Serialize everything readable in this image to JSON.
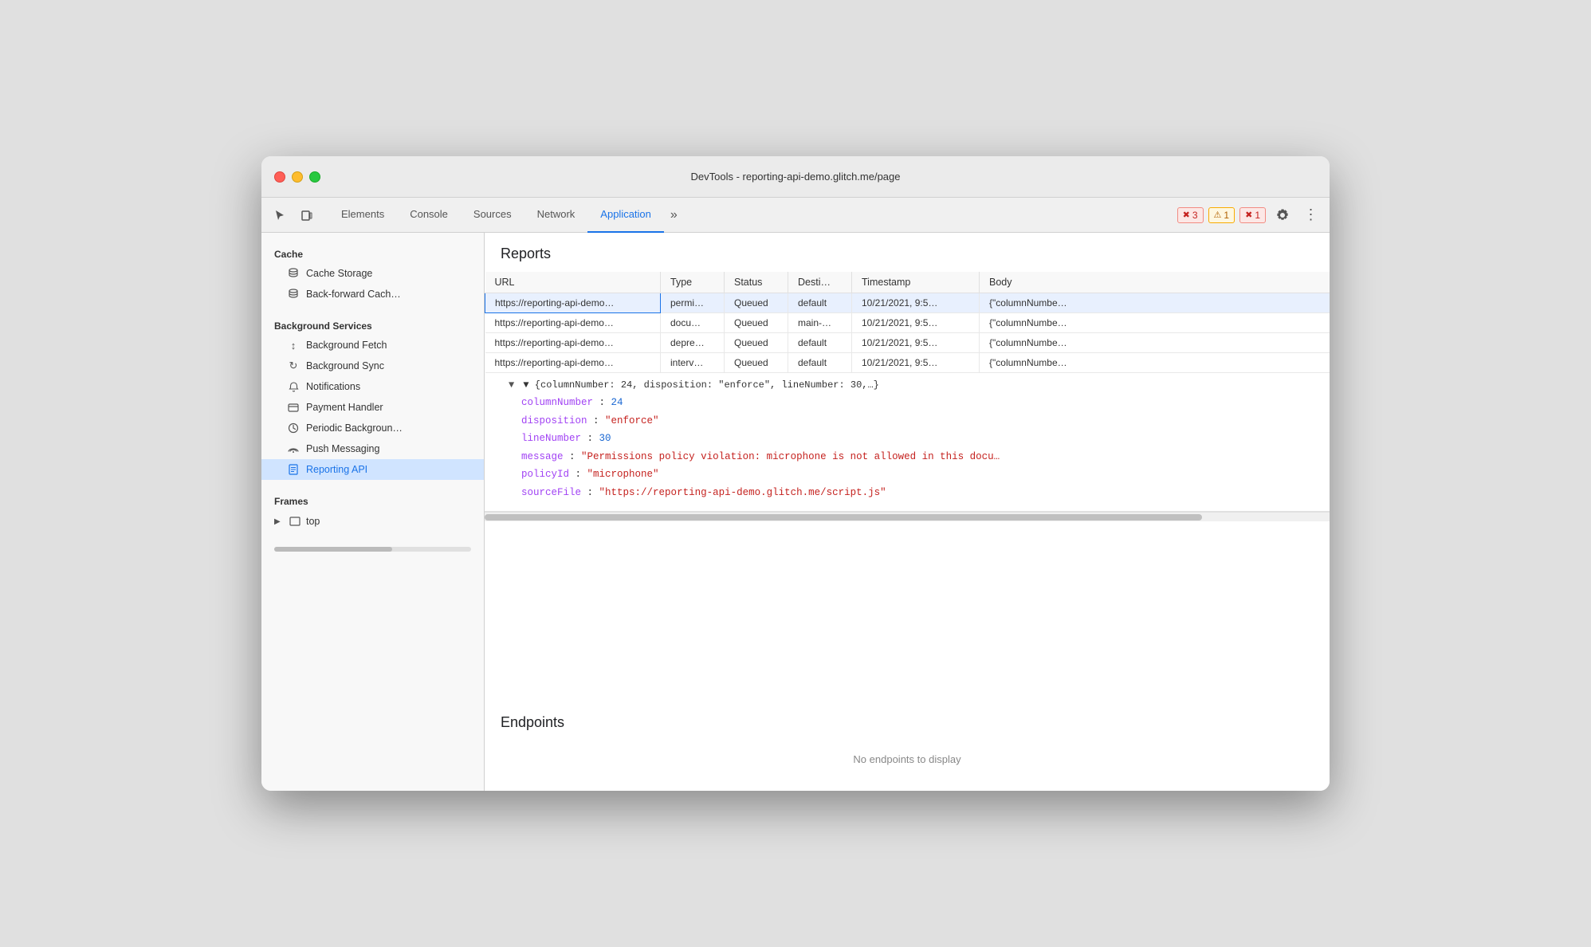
{
  "window": {
    "title": "DevTools - reporting-api-demo.glitch.me/page"
  },
  "toolbar": {
    "icons": [
      {
        "name": "cursor-icon",
        "symbol": "↖"
      },
      {
        "name": "device-icon",
        "symbol": "⬜"
      }
    ],
    "tabs": [
      {
        "id": "elements",
        "label": "Elements",
        "active": false
      },
      {
        "id": "console",
        "label": "Console",
        "active": false
      },
      {
        "id": "sources",
        "label": "Sources",
        "active": false
      },
      {
        "id": "network",
        "label": "Network",
        "active": false
      },
      {
        "id": "application",
        "label": "Application",
        "active": true
      }
    ],
    "more_tabs_symbol": "»",
    "error_badge": {
      "icon": "✖",
      "count": "3"
    },
    "warning_badge": {
      "icon": "⚠",
      "count": "1"
    },
    "error_badge2": {
      "icon": "✖",
      "count": "1"
    },
    "gear_symbol": "⚙",
    "more_symbol": "⋮"
  },
  "sidebar": {
    "sections": [
      {
        "label": "Cache",
        "items": [
          {
            "id": "cache-storage",
            "label": "Cache Storage",
            "icon": "🗄"
          },
          {
            "id": "back-forward-cache",
            "label": "Back-forward Cach…",
            "icon": "🗄"
          }
        ]
      },
      {
        "label": "Background Services",
        "items": [
          {
            "id": "background-fetch",
            "label": "Background Fetch",
            "icon": "↕"
          },
          {
            "id": "background-sync",
            "label": "Background Sync",
            "icon": "↻"
          },
          {
            "id": "notifications",
            "label": "Notifications",
            "icon": "🔔"
          },
          {
            "id": "payment-handler",
            "label": "Payment Handler",
            "icon": "💳"
          },
          {
            "id": "periodic-background",
            "label": "Periodic Backgroun…",
            "icon": "🕐"
          },
          {
            "id": "push-messaging",
            "label": "Push Messaging",
            "icon": "☁"
          },
          {
            "id": "reporting-api",
            "label": "Reporting API",
            "icon": "📄",
            "active": true
          }
        ]
      },
      {
        "label": "Frames",
        "items": [
          {
            "id": "top",
            "label": "top",
            "icon": "⬜",
            "hasArrow": true
          }
        ]
      }
    ]
  },
  "reports": {
    "title": "Reports",
    "table": {
      "columns": [
        "URL",
        "Type",
        "Status",
        "Desti…",
        "Timestamp",
        "Body"
      ],
      "rows": [
        {
          "url": "https://reporting-api-demo…",
          "type": "permi…",
          "status": "Queued",
          "destination": "default",
          "timestamp": "10/21/2021, 9:5…",
          "body": "{\"columnNumbe…",
          "selected": true
        },
        {
          "url": "https://reporting-api-demo…",
          "type": "docu…",
          "status": "Queued",
          "destination": "main-…",
          "timestamp": "10/21/2021, 9:5…",
          "body": "{\"columnNumbe…",
          "selected": false
        },
        {
          "url": "https://reporting-api-demo…",
          "type": "depre…",
          "status": "Queued",
          "destination": "default",
          "timestamp": "10/21/2021, 9:5…",
          "body": "{\"columnNumbe…",
          "selected": false
        },
        {
          "url": "https://reporting-api-demo…",
          "type": "interv…",
          "status": "Queued",
          "destination": "default",
          "timestamp": "10/21/2021, 9:5…",
          "body": "{\"columnNumbe…",
          "selected": false
        }
      ]
    },
    "expanded_detail": {
      "header": "▼ {columnNumber: 24, disposition: \"enforce\", lineNumber: 30,…}",
      "lines": [
        {
          "key": "columnNumber",
          "colon": ":",
          "value": "24",
          "type": "number"
        },
        {
          "key": "disposition",
          "colon": ":",
          "value": "\"enforce\"",
          "type": "string"
        },
        {
          "key": "lineNumber",
          "colon": ":",
          "value": "30",
          "type": "number"
        },
        {
          "key": "message",
          "colon": ":",
          "value": "\"Permissions policy violation: microphone is not allowed in this docu…",
          "type": "string"
        },
        {
          "key": "policyId",
          "colon": ":",
          "value": "\"microphone\"",
          "type": "string"
        },
        {
          "key": "sourceFile",
          "colon": ":",
          "value": "\"https://reporting-api-demo.glitch.me/script.js\"",
          "type": "string"
        }
      ]
    }
  },
  "endpoints": {
    "title": "Endpoints",
    "empty_message": "No endpoints to display"
  }
}
